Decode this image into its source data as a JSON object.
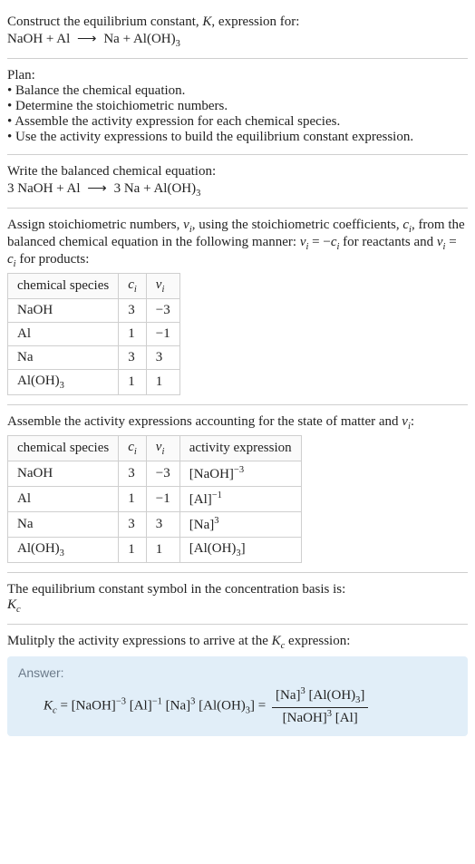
{
  "title_prefix": "Construct the equilibrium constant, ",
  "title_K": "K",
  "title_suffix": ", expression for:",
  "unbalanced_eq": {
    "lhs1": "NaOH",
    "plus1": " + ",
    "lhs2": "Al",
    "arrow": "⟶",
    "rhs1": "Na",
    "plus2": " + ",
    "rhs2_base": "Al(OH)",
    "rhs2_sub": "3"
  },
  "plan_label": "Plan:",
  "plan_items": [
    "Balance the chemical equation.",
    "Determine the stoichiometric numbers.",
    "Assemble the activity expression for each chemical species.",
    "Use the activity expressions to build the equilibrium constant expression."
  ],
  "balanced_label": "Write the balanced chemical equation:",
  "balanced_eq": {
    "l1": "3 NaOH",
    "plus1": " + ",
    "l2": "Al",
    "arrow": "⟶",
    "r1": "3 Na",
    "plus2": " + ",
    "r2_base": "Al(OH)",
    "r2_sub": "3"
  },
  "stoich_text": {
    "p1": "Assign stoichiometric numbers, ",
    "nu": "ν",
    "nu_i": "i",
    "p2": ", using the stoichiometric coefficients, ",
    "c": "c",
    "c_i": "i",
    "p3": ", from the balanced chemical equation in the following manner: ",
    "eq1a": "ν",
    "eq1b": "i",
    "eq1c": " = −",
    "eq1d": "c",
    "eq1e": "i",
    "p4": " for reactants and ",
    "eq2a": "ν",
    "eq2b": "i",
    "eq2c": " = ",
    "eq2d": "c",
    "eq2e": "i",
    "p5": " for products:"
  },
  "table1": {
    "h1": "chemical species",
    "h2_base": "c",
    "h2_sub": "i",
    "h3_base": "ν",
    "h3_sub": "i",
    "rows": [
      {
        "species": "NaOH",
        "c": "3",
        "nu": "−3"
      },
      {
        "species": "Al",
        "c": "1",
        "nu": "−1"
      },
      {
        "species": "Na",
        "c": "3",
        "nu": "3"
      },
      {
        "species_base": "Al(OH)",
        "species_sub": "3",
        "c": "1",
        "nu": "1"
      }
    ]
  },
  "activity_label_a": "Assemble the activity expressions accounting for the state of matter and ",
  "activity_label_b": "ν",
  "activity_label_c": "i",
  "activity_label_d": ":",
  "table2": {
    "h1": "chemical species",
    "h2_base": "c",
    "h2_sub": "i",
    "h3_base": "ν",
    "h3_sub": "i",
    "h4": "activity expression",
    "rows": [
      {
        "species": "NaOH",
        "c": "3",
        "nu": "−3",
        "act_base": "[NaOH]",
        "act_sup": "−3"
      },
      {
        "species": "Al",
        "c": "1",
        "nu": "−1",
        "act_base": "[Al]",
        "act_sup": "−1"
      },
      {
        "species": "Na",
        "c": "3",
        "nu": "3",
        "act_base": "[Na]",
        "act_sup": "3"
      },
      {
        "species_base": "Al(OH)",
        "species_sub": "3",
        "c": "1",
        "nu": "1",
        "act_base": "[Al(OH)",
        "act_sub": "3",
        "act_tail": "]"
      }
    ]
  },
  "kc_symbol_line": "The equilibrium constant symbol in the concentration basis is:",
  "kc_symbol_base": "K",
  "kc_symbol_sub": "c",
  "multiply_a": "Mulitply the activity expressions to arrive at the ",
  "multiply_b": "K",
  "multiply_c": "c",
  "multiply_d": " expression:",
  "answer_label": "Answer:",
  "answer": {
    "Kc_base": "K",
    "Kc_sub": "c",
    "eq": " = ",
    "f1": "[NaOH]",
    "f1_sup": "−3",
    "f2": " [Al]",
    "f2_sup": "−1",
    "f3": " [Na]",
    "f3_sup": "3",
    "f4": " [Al(OH)",
    "f4_sub": "3",
    "f4_tail": "] ",
    "eq2": "= ",
    "num_a": "[Na]",
    "num_a_sup": "3",
    "num_b": " [Al(OH)",
    "num_b_sub": "3",
    "num_b_tail": "]",
    "den_a": "[NaOH]",
    "den_a_sup": "3",
    "den_b": " [Al]"
  }
}
